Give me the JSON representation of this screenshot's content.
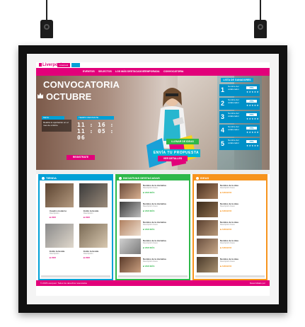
{
  "brand": {
    "logo": "Liverpool",
    "badge": "Liverpool"
  },
  "nav": [
    "EVENTOS",
    "SELECTOS",
    "LOS MÁS DESTACADOS",
    "TEMPORADA",
    "CONVOCATORIA"
  ],
  "hero": {
    "title_line1": "CONVOCATORIA",
    "title_line2": "OCTUBRE",
    "tab_left": "META",
    "tab_right": "TIEMPO RESTANTE",
    "info_text": "Realiza tu aportación en el mes de octubre",
    "countdown": "11 : 16 : 11 : 05 : 06",
    "btn_pink_left": "REGISTRATE",
    "btn_green": "LLENAR DE IDEAS",
    "btn_cyan": "ENVÍA TU PROPUESTA",
    "btn_pink_center": "VER DETALLES"
  },
  "ranking": {
    "title": "LISTA DE GANADORES",
    "items": [
      {
        "num": "1",
        "text": "Nombre del colaborador",
        "pts": "PTS",
        "stars": "★★★★★"
      },
      {
        "num": "2",
        "text": "Nombre del colaborador",
        "pts": "PTS",
        "stars": "★★★★★"
      },
      {
        "num": "3",
        "text": "Nombre del colaborador",
        "pts": "PTS",
        "stars": "★★★★★"
      },
      {
        "num": "4",
        "text": "Nombre del colaborador",
        "pts": "PTS",
        "stars": "★★★★★"
      },
      {
        "num": "5",
        "text": "Nombre del colaborador",
        "pts": "PTS",
        "stars": "★★★★★"
      }
    ]
  },
  "columns": {
    "c1": {
      "title": "TIENDA",
      "items": [
        {
          "title": "Cuadro moderno",
          "line": "Descripción",
          "tag": "VER"
        },
        {
          "title": "Estilo la tienda",
          "line": "Descripción",
          "tag": "VER"
        },
        {
          "title": "Estilo la tienda",
          "line": "Descripción",
          "tag": "VER"
        },
        {
          "title": "Estilo la tienda",
          "line": "Descripción",
          "tag": "VER"
        }
      ]
    },
    "c2": {
      "title": "INICIATIVAS DESTACADAS",
      "items": [
        {
          "title": "Nombre de la iniciativa",
          "line": "Descripción breve",
          "tag": "VER MÁS"
        },
        {
          "title": "Nombre de la iniciativa",
          "line": "Descripción breve",
          "tag": "VER MÁS"
        },
        {
          "title": "Nombre de la iniciativa",
          "line": "Descripción breve",
          "tag": "VER MÁS"
        },
        {
          "title": "Nombre de la iniciativa",
          "line": "Descripción breve",
          "tag": "VER MÁS"
        },
        {
          "title": "Nombre de la iniciativa",
          "line": "Descripción breve",
          "tag": "VER MÁS"
        }
      ]
    },
    "c3": {
      "title": "IDEAS",
      "items": [
        {
          "title": "Nombre de la idea",
          "line": "Descripción breve",
          "tag": "ARCHIVO"
        },
        {
          "title": "Nombre de la idea",
          "line": "Descripción breve",
          "tag": "ARCHIVO"
        },
        {
          "title": "Nombre de la idea",
          "line": "Descripción breve",
          "tag": "ARCHIVO"
        },
        {
          "title": "Nombre de la idea",
          "line": "Descripción breve",
          "tag": "ARCHIVO"
        },
        {
          "title": "Nombre de la idea",
          "line": "Descripción breve",
          "tag": "ARCHIVO"
        }
      ]
    }
  },
  "footer": {
    "left": "© 2015 Liverpool. Todos los derechos reservados",
    "right": "Desarrollado por"
  },
  "colors": {
    "pink": "#e2007a",
    "cyan": "#00a0d6",
    "green": "#2eb84a",
    "orange": "#f7941d"
  }
}
